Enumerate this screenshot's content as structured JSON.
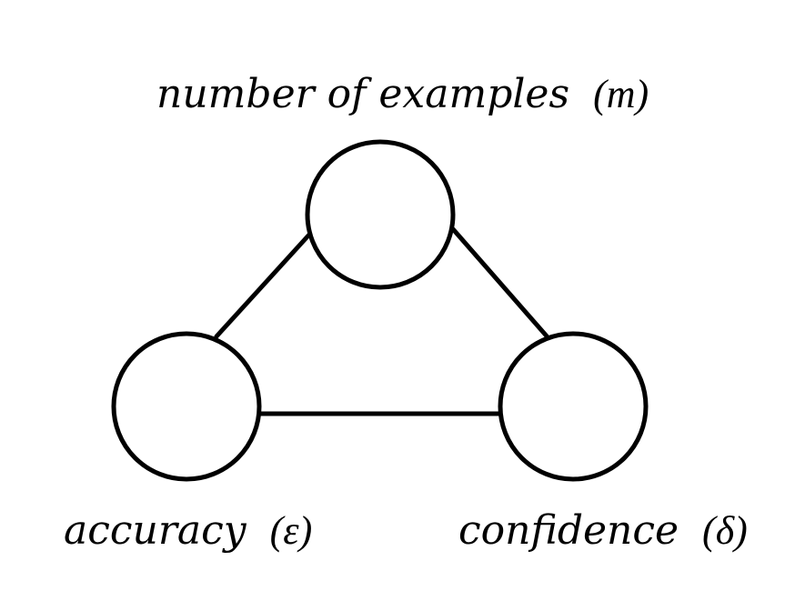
{
  "diagram": {
    "nodes": [
      {
        "id": "top",
        "label": "number of examples",
        "symbol": "(m)"
      },
      {
        "id": "left",
        "label": "accuracy",
        "symbol": "(ε)"
      },
      {
        "id": "right",
        "label": "confidence",
        "symbol": "(δ)"
      }
    ],
    "edges": [
      {
        "from": "top",
        "to": "left"
      },
      {
        "from": "top",
        "to": "right"
      },
      {
        "from": "left",
        "to": "right"
      }
    ]
  }
}
